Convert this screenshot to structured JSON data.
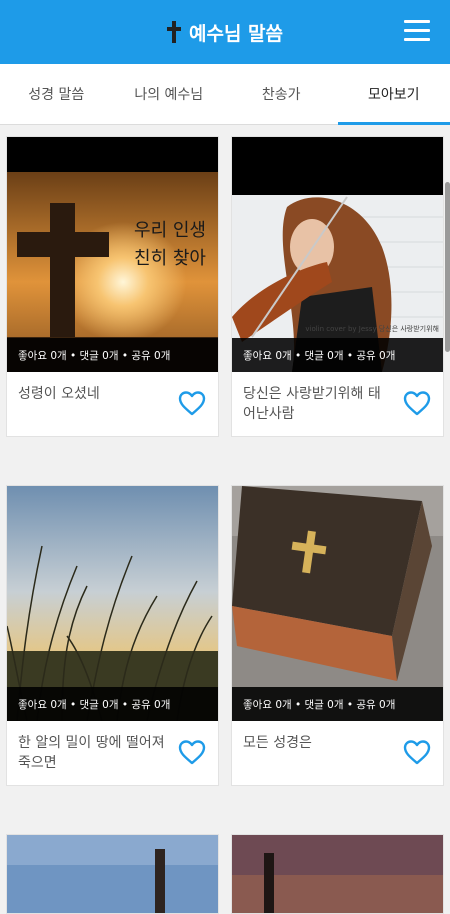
{
  "app": {
    "title": "예수님 말씀",
    "icons": {
      "cross": "cross-icon",
      "menu": "menu-icon",
      "heart": "heart-icon"
    },
    "colors": {
      "primary": "#1e9be8",
      "heart": "#1e9be8"
    }
  },
  "tabs": [
    {
      "label": "성경 말씀",
      "active": false
    },
    {
      "label": "나의 예수님",
      "active": false
    },
    {
      "label": "찬송가",
      "active": false
    },
    {
      "label": "모아보기",
      "active": true
    }
  ],
  "cards": [
    {
      "title": "성령이 오셨네",
      "stats": "좋아요 0개 • 댓글 0개 • 공유 0개",
      "overlay": [
        "우리 인생",
        "친히 찾아"
      ]
    },
    {
      "title": "당신은 사랑받기위해 태어난사람",
      "stats": "좋아요 0개 • 댓글 0개 • 공유 0개",
      "overlay_small": "violin cover by Jessy  당신은 사랑받기위해"
    },
    {
      "title": "한 알의 밀이 땅에 떨어져 죽으면",
      "stats": "좋아요 0개 • 댓글 0개 • 공유 0개"
    },
    {
      "title": "모든 성경은",
      "stats": "좋아요 0개 • 댓글 0개 • 공유 0개"
    }
  ]
}
